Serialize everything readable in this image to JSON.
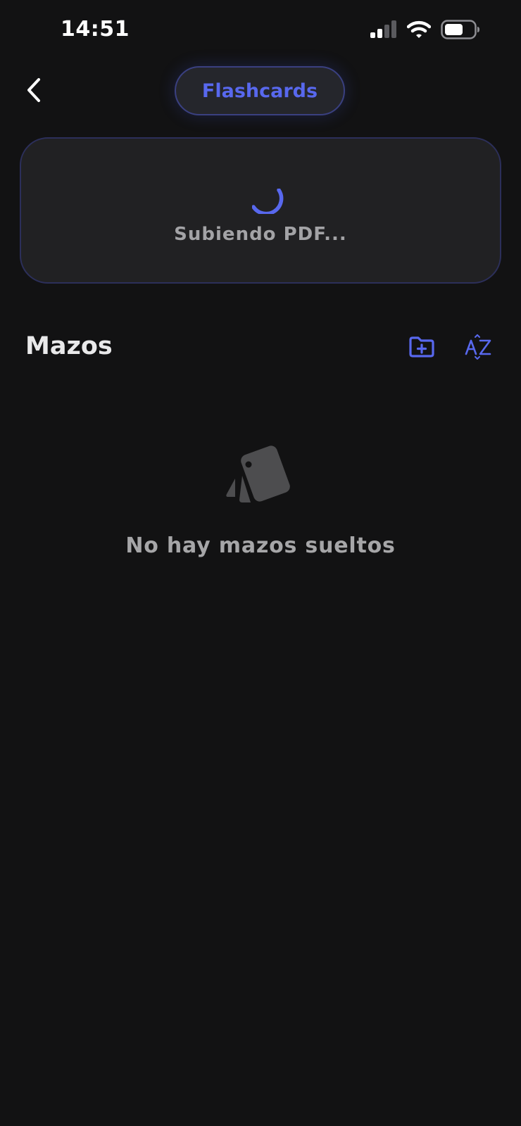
{
  "status_bar": {
    "time": "14:51",
    "icons": [
      "cellular-signal-icon",
      "wifi-icon",
      "battery-icon"
    ]
  },
  "header": {
    "back_icon": "chevron-left-icon",
    "title": "Flashcards"
  },
  "upload": {
    "status_text": "Subiendo PDF...",
    "spinner_icon": "loading-spinner-icon"
  },
  "decks_section": {
    "title": "Mazos",
    "actions": [
      {
        "icon": "folder-plus-icon"
      },
      {
        "icon": "sort-az-icon"
      }
    ]
  },
  "empty_state": {
    "icon": "cards-stack-icon",
    "message": "No hay mazos sueltos"
  },
  "colors": {
    "background": "#121213",
    "accent": "#5868ee",
    "card_background": "#212123",
    "muted_text": "#a6a6a8"
  }
}
